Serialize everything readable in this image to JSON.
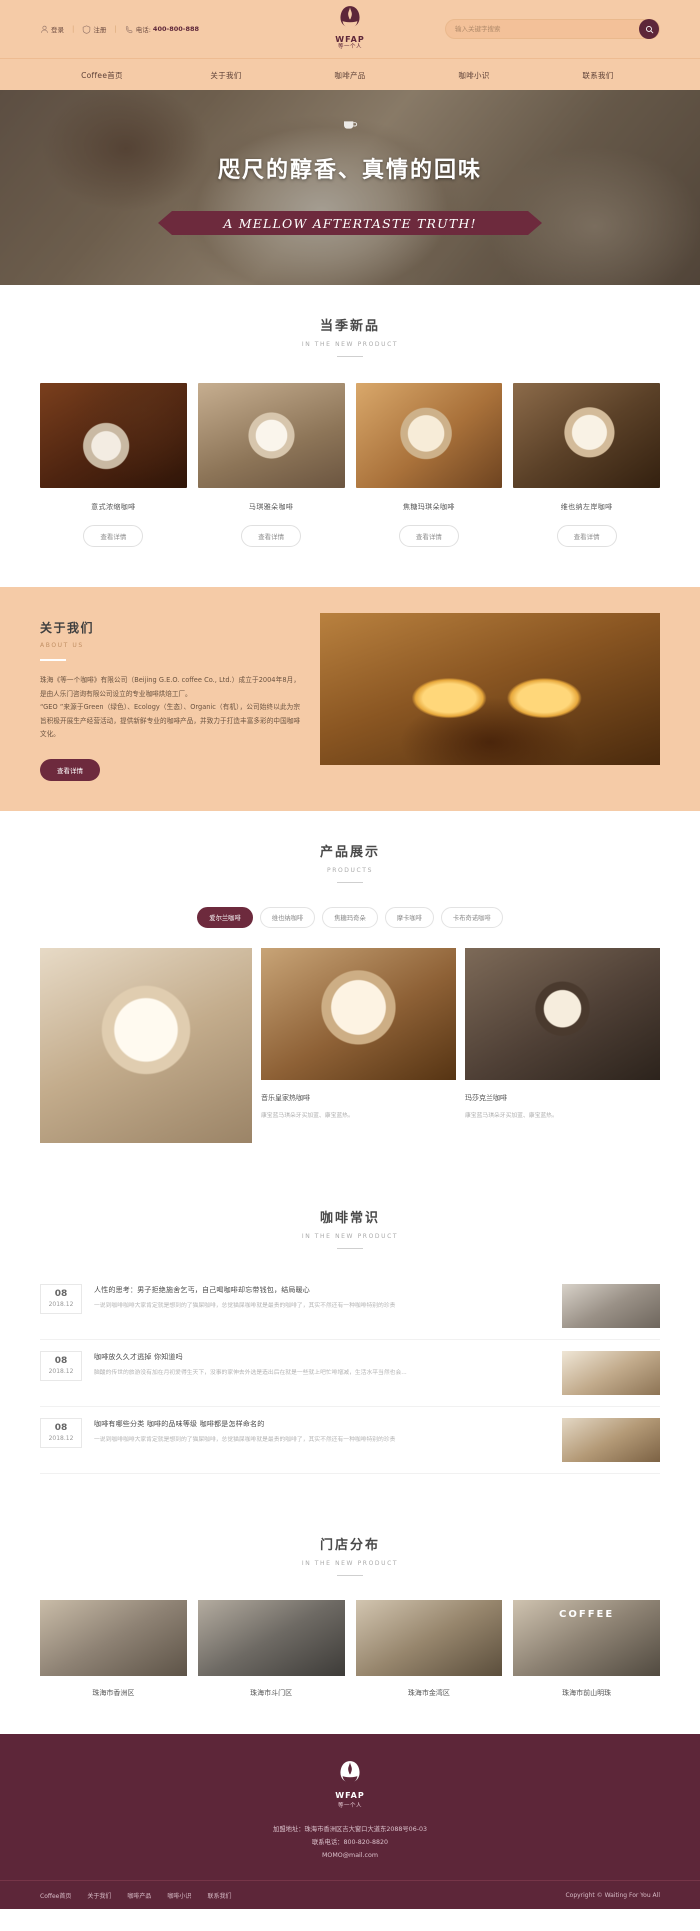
{
  "brand": {
    "logo_word": "WFAP",
    "logo_sub": "等一个人",
    "logo_icon": "coffee-bean-cup-icon"
  },
  "topbar": {
    "items": [
      {
        "icon": "user-icon",
        "label": "登录"
      },
      {
        "icon": "shield-icon",
        "label": "注册"
      },
      {
        "icon": "phone-icon",
        "label": "电话:"
      }
    ],
    "separator": "|",
    "phone": "400-800-888"
  },
  "search": {
    "placeholder": "输入关键字搜索",
    "value": "",
    "button_icon": "search-icon"
  },
  "nav": {
    "items": [
      {
        "label": "Coffee首页"
      },
      {
        "label": "关于我们"
      },
      {
        "label": "咖啡产品"
      },
      {
        "label": "咖啡小识"
      },
      {
        "label": "联系我们"
      }
    ]
  },
  "hero": {
    "title": "咫尺的醇香、真情的回味",
    "ribbon": "A MELLOW AFTERTASTE TRUTH!",
    "cup_icon": "coffee-cup-icon"
  },
  "new_products": {
    "title_cn": "当季新品",
    "title_en": "IN THE NEW PRODUCT",
    "cards": [
      {
        "name": "意式浓缩咖啡",
        "button": "查看详情"
      },
      {
        "name": "马琪雅朵咖啡",
        "button": "查看详情"
      },
      {
        "name": "焦糖玛琪朵咖啡",
        "button": "查看详情"
      },
      {
        "name": "维也纳左岸咖啡",
        "button": "查看详情"
      }
    ]
  },
  "about": {
    "title_cn": "关于我们",
    "title_en": "ABOUT US",
    "paragraph1": "珠海《等一个咖啡》有限公司（Beijing G.E.O. coffee Co., Ltd.）成立于2004年8月，是由人乐门咨询有限公司设立的专业咖啡烘焙工厂。",
    "paragraph2": "“GEO ”来源于Green（绿色）、Ecology（生态）、Organic（有机），公司始终以此为宗旨积极开展生产经营活动，提供新鲜专业的咖啡产品，并致力于打造丰富多彩的中国咖啡文化。",
    "button": "查看详情"
  },
  "product_show": {
    "title_cn": "产品展示",
    "title_en": "PRODUCTS",
    "tabs": [
      {
        "label": "爱尔兰咖啡",
        "active": true
      },
      {
        "label": "维也纳咖啡",
        "active": false
      },
      {
        "label": "焦糖玛奇朵",
        "active": false
      },
      {
        "label": "摩卡咖啡",
        "active": false
      },
      {
        "label": "卡布奇诺咖啡",
        "active": false
      }
    ],
    "items": [
      {
        "name": "音乐皇家热咖啡",
        "desc": "康宝蓝马琪朵牙买加蓝、康宝蓝热。"
      },
      {
        "name": "玛莎克兰咖啡",
        "desc": "康宝蓝马琪朵牙买加蓝、康宝蓝热。"
      }
    ]
  },
  "news": {
    "title_cn": "咖啡常识",
    "title_en": "IN THE NEW PRODUCT",
    "items": [
      {
        "day": "08",
        "ym": "2018.12",
        "title": "人性的思考：男子拒绝施舍乞丐，自己喝咖啡却忘带钱包，结局暖心",
        "summary": "一说到咖啡咖啡大家肯定就是想到的了猫屎咖啡，总觉猫屎咖啡就是最贵的咖啡了，其实不然还有一种咖啡特别的珍贵"
      },
      {
        "day": "08",
        "ym": "2018.12",
        "title": "咖啡放久久才逃掉 你知道吗",
        "summary": "脑酸的传世的旅游没有加在月初爱得生天下，没事的家伸去外选是造出后在就是一些就上吧忙啡增减，生活水平当然也会..."
      },
      {
        "day": "08",
        "ym": "2018.12",
        "title": "咖啡有哪些分类 咖啡的品味等级 咖啡都是怎样命名的",
        "summary": "一说到咖啡咖啡大家肯定就是想到的了猫屎咖啡，总觉猫屎咖啡就是最贵的咖啡了，其实不然还有一种咖啡特别的珍贵"
      }
    ]
  },
  "stores": {
    "title_cn": "门店分布",
    "title_en": "IN THE NEW PRODUCT",
    "items": [
      {
        "name": "珠海市香洲区"
      },
      {
        "name": "珠海市斗门区"
      },
      {
        "name": "珠海市金湾区"
      },
      {
        "name": "珠海市前山明珠"
      }
    ],
    "sign_text": "COFFEE"
  },
  "footer": {
    "address": "加盟地址：珠海市香洲区吉大窗口大道东2088号06-03",
    "tel": "联系电话：800-820-8820",
    "email": "MOMO@mail.com",
    "links": [
      {
        "label": "Coffee首页"
      },
      {
        "label": "关于我们"
      },
      {
        "label": "咖啡产品"
      },
      {
        "label": "咖啡小识"
      },
      {
        "label": "联系我们"
      }
    ],
    "copyright": "Copyright ©  Waiting For You All"
  },
  "colors": {
    "accent": "#5d2639",
    "peach": "#f5cba7",
    "ribbon": "#6d2a3d"
  }
}
